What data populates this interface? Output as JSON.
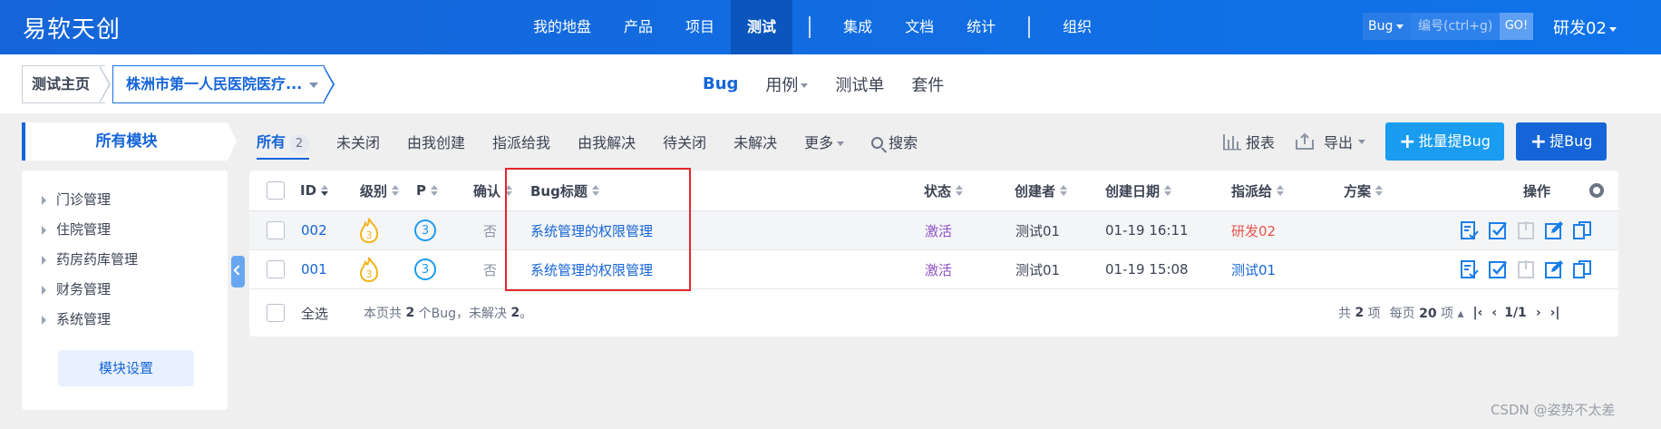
{
  "brand": "易软天创",
  "nav": {
    "items": [
      "我的地盘",
      "产品",
      "项目",
      "测试",
      "集成",
      "文档",
      "统计",
      "组织"
    ],
    "active": "测试"
  },
  "search": {
    "type": "Bug",
    "placeholder": "编号(ctrl+g)",
    "go": "GO!"
  },
  "user": "研发02",
  "breadcrumb": {
    "home": "测试主页",
    "product": "株洲市第一人民医院医疗..."
  },
  "subnav": {
    "bug": "Bug",
    "cases": "用例",
    "testtask": "测试单",
    "suite": "套件"
  },
  "sidebar": {
    "header": "所有模块",
    "items": [
      "门诊管理",
      "住院管理",
      "药房药库管理",
      "财务管理",
      "系统管理"
    ],
    "settings": "模块设置"
  },
  "filters": {
    "all": "所有",
    "all_count": "2",
    "unclosed": "未关闭",
    "created_by_me": "由我创建",
    "assigned_to_me": "指派给我",
    "resolved_by_me": "由我解决",
    "to_close": "待关闭",
    "unresolved": "未解决",
    "more": "更多",
    "search": "搜索"
  },
  "toolbar": {
    "report": "报表",
    "export": "导出",
    "batch_create": "批量提Bug",
    "create": "提Bug"
  },
  "table": {
    "headers": {
      "id": "ID",
      "severity": "级别",
      "pri": "P",
      "confirmed": "确认",
      "title": "Bug标题",
      "status": "状态",
      "creator": "创建者",
      "created_date": "创建日期",
      "assigned_to": "指派给",
      "solution": "方案",
      "actions": "操作"
    },
    "rows": [
      {
        "id": "002",
        "severity": "3",
        "pri": "3",
        "confirmed": "否",
        "title": "系统管理的权限管理",
        "status": "激活",
        "creator": "测试01",
        "date": "01-19 16:11",
        "assigned": "研发02"
      },
      {
        "id": "001",
        "severity": "3",
        "pri": "3",
        "confirmed": "否",
        "title": "系统管理的权限管理",
        "status": "激活",
        "creator": "测试01",
        "date": "01-19 15:08",
        "assigned": "测试01"
      }
    ]
  },
  "footer": {
    "select_all": "全选",
    "summary_prefix": "本页共",
    "summary_count": "2",
    "summary_mid": "个Bug，未解决",
    "summary_unresolved": "2",
    "summary_end": "。",
    "total_prefix": "共",
    "total": "2",
    "total_unit": "项",
    "per_page_prefix": "每页",
    "per_page": "20",
    "per_page_unit": "项",
    "page": "1/1"
  },
  "watermark": "CSDN @姿势不太差",
  "colors": {
    "primary": "#1565d8",
    "status_active": "#8e52c4",
    "assigned_red": "#e5534b",
    "highlight": "#e5262e"
  }
}
